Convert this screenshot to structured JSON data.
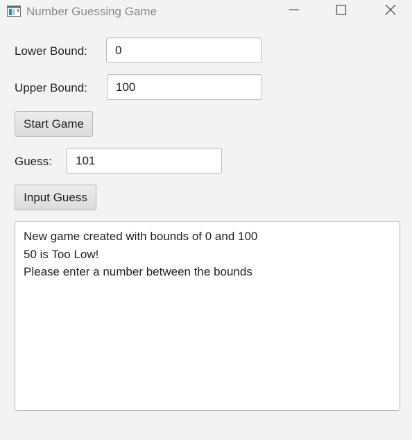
{
  "window": {
    "title": "Number Guessing Game"
  },
  "icons": {
    "app": "java-app-icon",
    "minimize": "minimize-icon",
    "maximize": "maximize-icon",
    "close": "close-icon"
  },
  "colors": {
    "background": "#f3f3f3",
    "field_background": "#ffffff",
    "border": "#bcbcbc",
    "title_text": "#8a8a8a"
  },
  "form": {
    "lower_bound": {
      "label": "Lower Bound:",
      "value": "0"
    },
    "upper_bound": {
      "label": "Upper Bound:",
      "value": "100"
    },
    "start_button": "Start Game",
    "guess": {
      "label": "Guess:",
      "value": "101"
    },
    "input_guess_button": "Input Guess"
  },
  "output": {
    "lines": [
      "New game created with bounds of 0 and 100",
      "50 is Too Low!",
      "Please enter a number between the bounds"
    ]
  }
}
